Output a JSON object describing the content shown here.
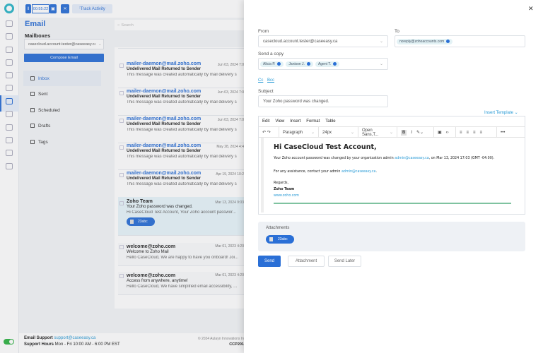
{
  "topbar": {
    "timer": "00:55:22",
    "track_activity": "Track Activity"
  },
  "left": {
    "title": "Email",
    "mailboxes_label": "Mailboxes",
    "mailbox": "casecloud.account.tester@caseeasy.ca",
    "compose": "Compose Email",
    "nav": [
      {
        "label": "Inbox",
        "icon": "inbox-icon"
      },
      {
        "label": "Sent",
        "icon": "sent-icon"
      },
      {
        "label": "Scheduled",
        "icon": "scheduled-icon"
      },
      {
        "label": "Drafts",
        "icon": "drafts-icon"
      },
      {
        "label": "Tags",
        "icon": "tag-icon"
      }
    ]
  },
  "search": {
    "placeholder": "Search"
  },
  "emails": [
    {
      "from": "mailer-daemon@mail.zoho.com",
      "date": "Jun 03, 2024 7:0",
      "subject": "Undelivered Mail Returned to Sender",
      "preview": "This message was created automatically by mail delivery s"
    },
    {
      "from": "mailer-daemon@mail.zoho.com",
      "date": "Jun 03, 2024 7:0",
      "subject": "Undelivered Mail Returned to Sender",
      "preview": "This message was created automatically by mail delivery s"
    },
    {
      "from": "mailer-daemon@mail.zoho.com",
      "date": "Jun 03, 2024 7:0",
      "subject": "Undelivered Mail Returned to Sender",
      "preview": "This message was created automatically by mail delivery s"
    },
    {
      "from": "mailer-daemon@mail.zoho.com",
      "date": "May 28, 2024 4:4",
      "subject": "Undelivered Mail Returned to Sender",
      "preview": "This message was created automatically by mail delivery s"
    },
    {
      "from": "mailer-daemon@mail.zoho.com",
      "date": "Apr 19, 2024 10:2",
      "subject": "Undelivered Mail Returned to Sender",
      "preview": "This message was created automatically by mail delivery s"
    },
    {
      "from": "Zoho Team",
      "date": "Mar 13, 2024 9:03",
      "subject": "Your Zoho password was changed.",
      "preview": "Hi CaseCloud Test Account, Your Zoho account passwor...",
      "attachment": "23abc"
    },
    {
      "from": "welcome@zoho.com",
      "date": "Mar 01, 2023 4:20",
      "subject": "Welcome to Zoho Mail",
      "preview": "Hello CaseCloud, We are happy to have you onboard! Joi..."
    },
    {
      "from": "welcome@zoho.com",
      "date": "Mar 01, 2023 4:20",
      "subject": "Access from anywhere, anytime!",
      "preview": "Hello CaseCloud, We have simplified email accessibility, ..."
    }
  ],
  "footer": {
    "support_label": "Email Support",
    "support_email": "support@caseeasy.ca",
    "hours_label": "Support Hours",
    "hours": "Mon - Fri 10:00 AM - 6:00 PM EST",
    "copyright": "© 2024 Aulayn Innovations In",
    "code": "CCP201"
  },
  "compose": {
    "from_label": "From",
    "from": "casecloud.account.tester@caseeasy.ca",
    "to_label": "To",
    "to": [
      "noreply@zohoaccounts.com"
    ],
    "copy_label": "Send a copy",
    "copy": [
      "Alicia P.",
      "Janison J.",
      "Agent T."
    ],
    "cc": "Cc",
    "bcc": "Bcc",
    "subject_label": "Subject",
    "subject": "Your Zoho password was changed.",
    "insert_template": "Insert Template",
    "menu": [
      "Edit",
      "View",
      "Insert",
      "Format",
      "Table"
    ],
    "block": "Paragraph",
    "size": "24px",
    "font": "Open Sans,T...",
    "body": {
      "greeting": "Hi CaseCloud Test Account,",
      "line1a": "Your Zoho account password was changed by your organization admin ",
      "line1link": "admin@caseeasy.ca",
      "line1b": ", on Mar 13, 2024 17:03 (GMT -04:00).",
      "line2a": "For any assistance, contact your admin ",
      "line2link": "admin@caseeasy.ca",
      "line2b": ".",
      "regards": "Regards,",
      "team": "Zoho Team",
      "site": "www.zoho.com"
    },
    "attachments_label": "Attachments",
    "attachment": "23abc",
    "send": "Send",
    "attach": "Attachment",
    "send_later": "Send Later"
  },
  "colors": {
    "accent": "#2a6fd6",
    "link": "#2a9bd6",
    "toggle": "#2fb344"
  }
}
